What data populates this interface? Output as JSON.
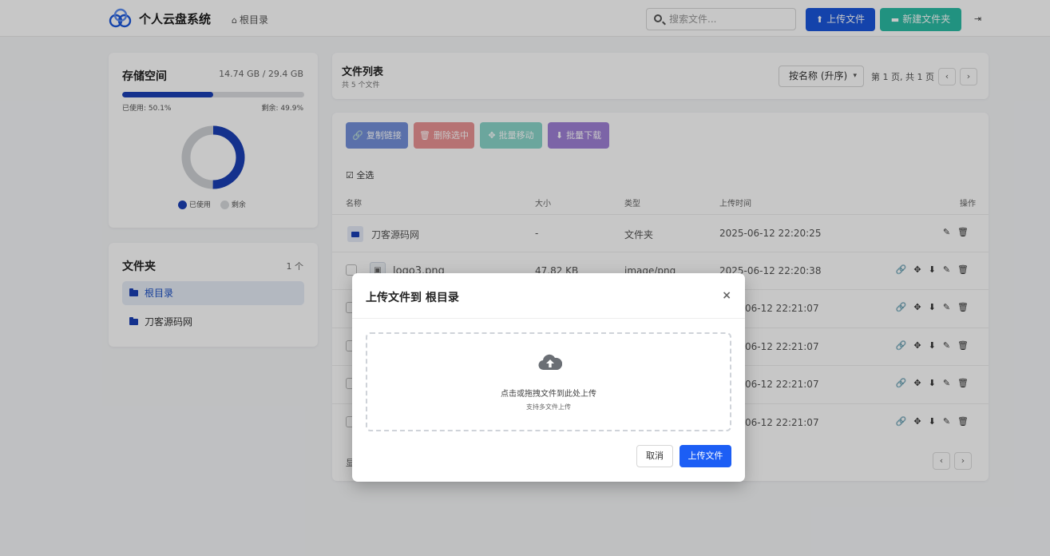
{
  "header": {
    "app_title": "个人云盘系统",
    "breadcrumb": "根目录",
    "search_placeholder": "搜索文件...",
    "upload_label": "上传文件",
    "new_folder_label": "新建文件夹",
    "home_icon": "home-icon",
    "logout_icon": "logout-icon"
  },
  "storage": {
    "title": "存储空间",
    "amount": "14.74 GB / 29.4 GB",
    "used_label": "已使用: 50.1%",
    "free_label": "剩余: 49.9%",
    "used_fraction": 0.501,
    "legend_used": "已使用",
    "legend_free": "剩余",
    "used_color": "#1a3fb5",
    "free_color": "#cfd1d5"
  },
  "folders": {
    "title": "文件夹",
    "count": "1 个",
    "items": [
      {
        "label": "根目录"
      },
      {
        "label": "刀客源码网"
      }
    ]
  },
  "file_list": {
    "title": "文件列表",
    "subtitle": "共 5 个文件",
    "sort_selected": "按名称 (升序)",
    "page_info": "第 1 页, 共 1 页",
    "prev": "‹",
    "next": "›",
    "actions": {
      "copy_link": "复制链接",
      "delete_selected": "删除选中",
      "batch_move": "批量移动",
      "batch_download": "批量下载"
    },
    "select_all": "全选",
    "columns": {
      "name": "名称",
      "size": "大小",
      "type": "类型",
      "time": "上传时间",
      "ops": "操作"
    },
    "rows": [
      {
        "name": "刀客源码网",
        "size": "-",
        "type": "文件夹",
        "time": "2025-06-12 22:20:25"
      },
      {
        "name": "logo3.png",
        "size": "47.82 KB",
        "type": "image/png",
        "time": "2025-06-12 22:20:38"
      },
      {
        "time_partial": "06-12 22:21:07"
      },
      {
        "time_partial": "06-12 22:21:07"
      },
      {
        "time_partial": "06-12 22:21:07"
      },
      {
        "time_partial": "06-12 22:21:07"
      }
    ],
    "footer_partial": "显"
  },
  "modal": {
    "title": "上传文件到 根目录",
    "close": "×",
    "drop_main": "点击或拖拽文件到此处上传",
    "drop_sub": "支持多文件上传",
    "cancel": "取消",
    "confirm": "上传文件"
  }
}
